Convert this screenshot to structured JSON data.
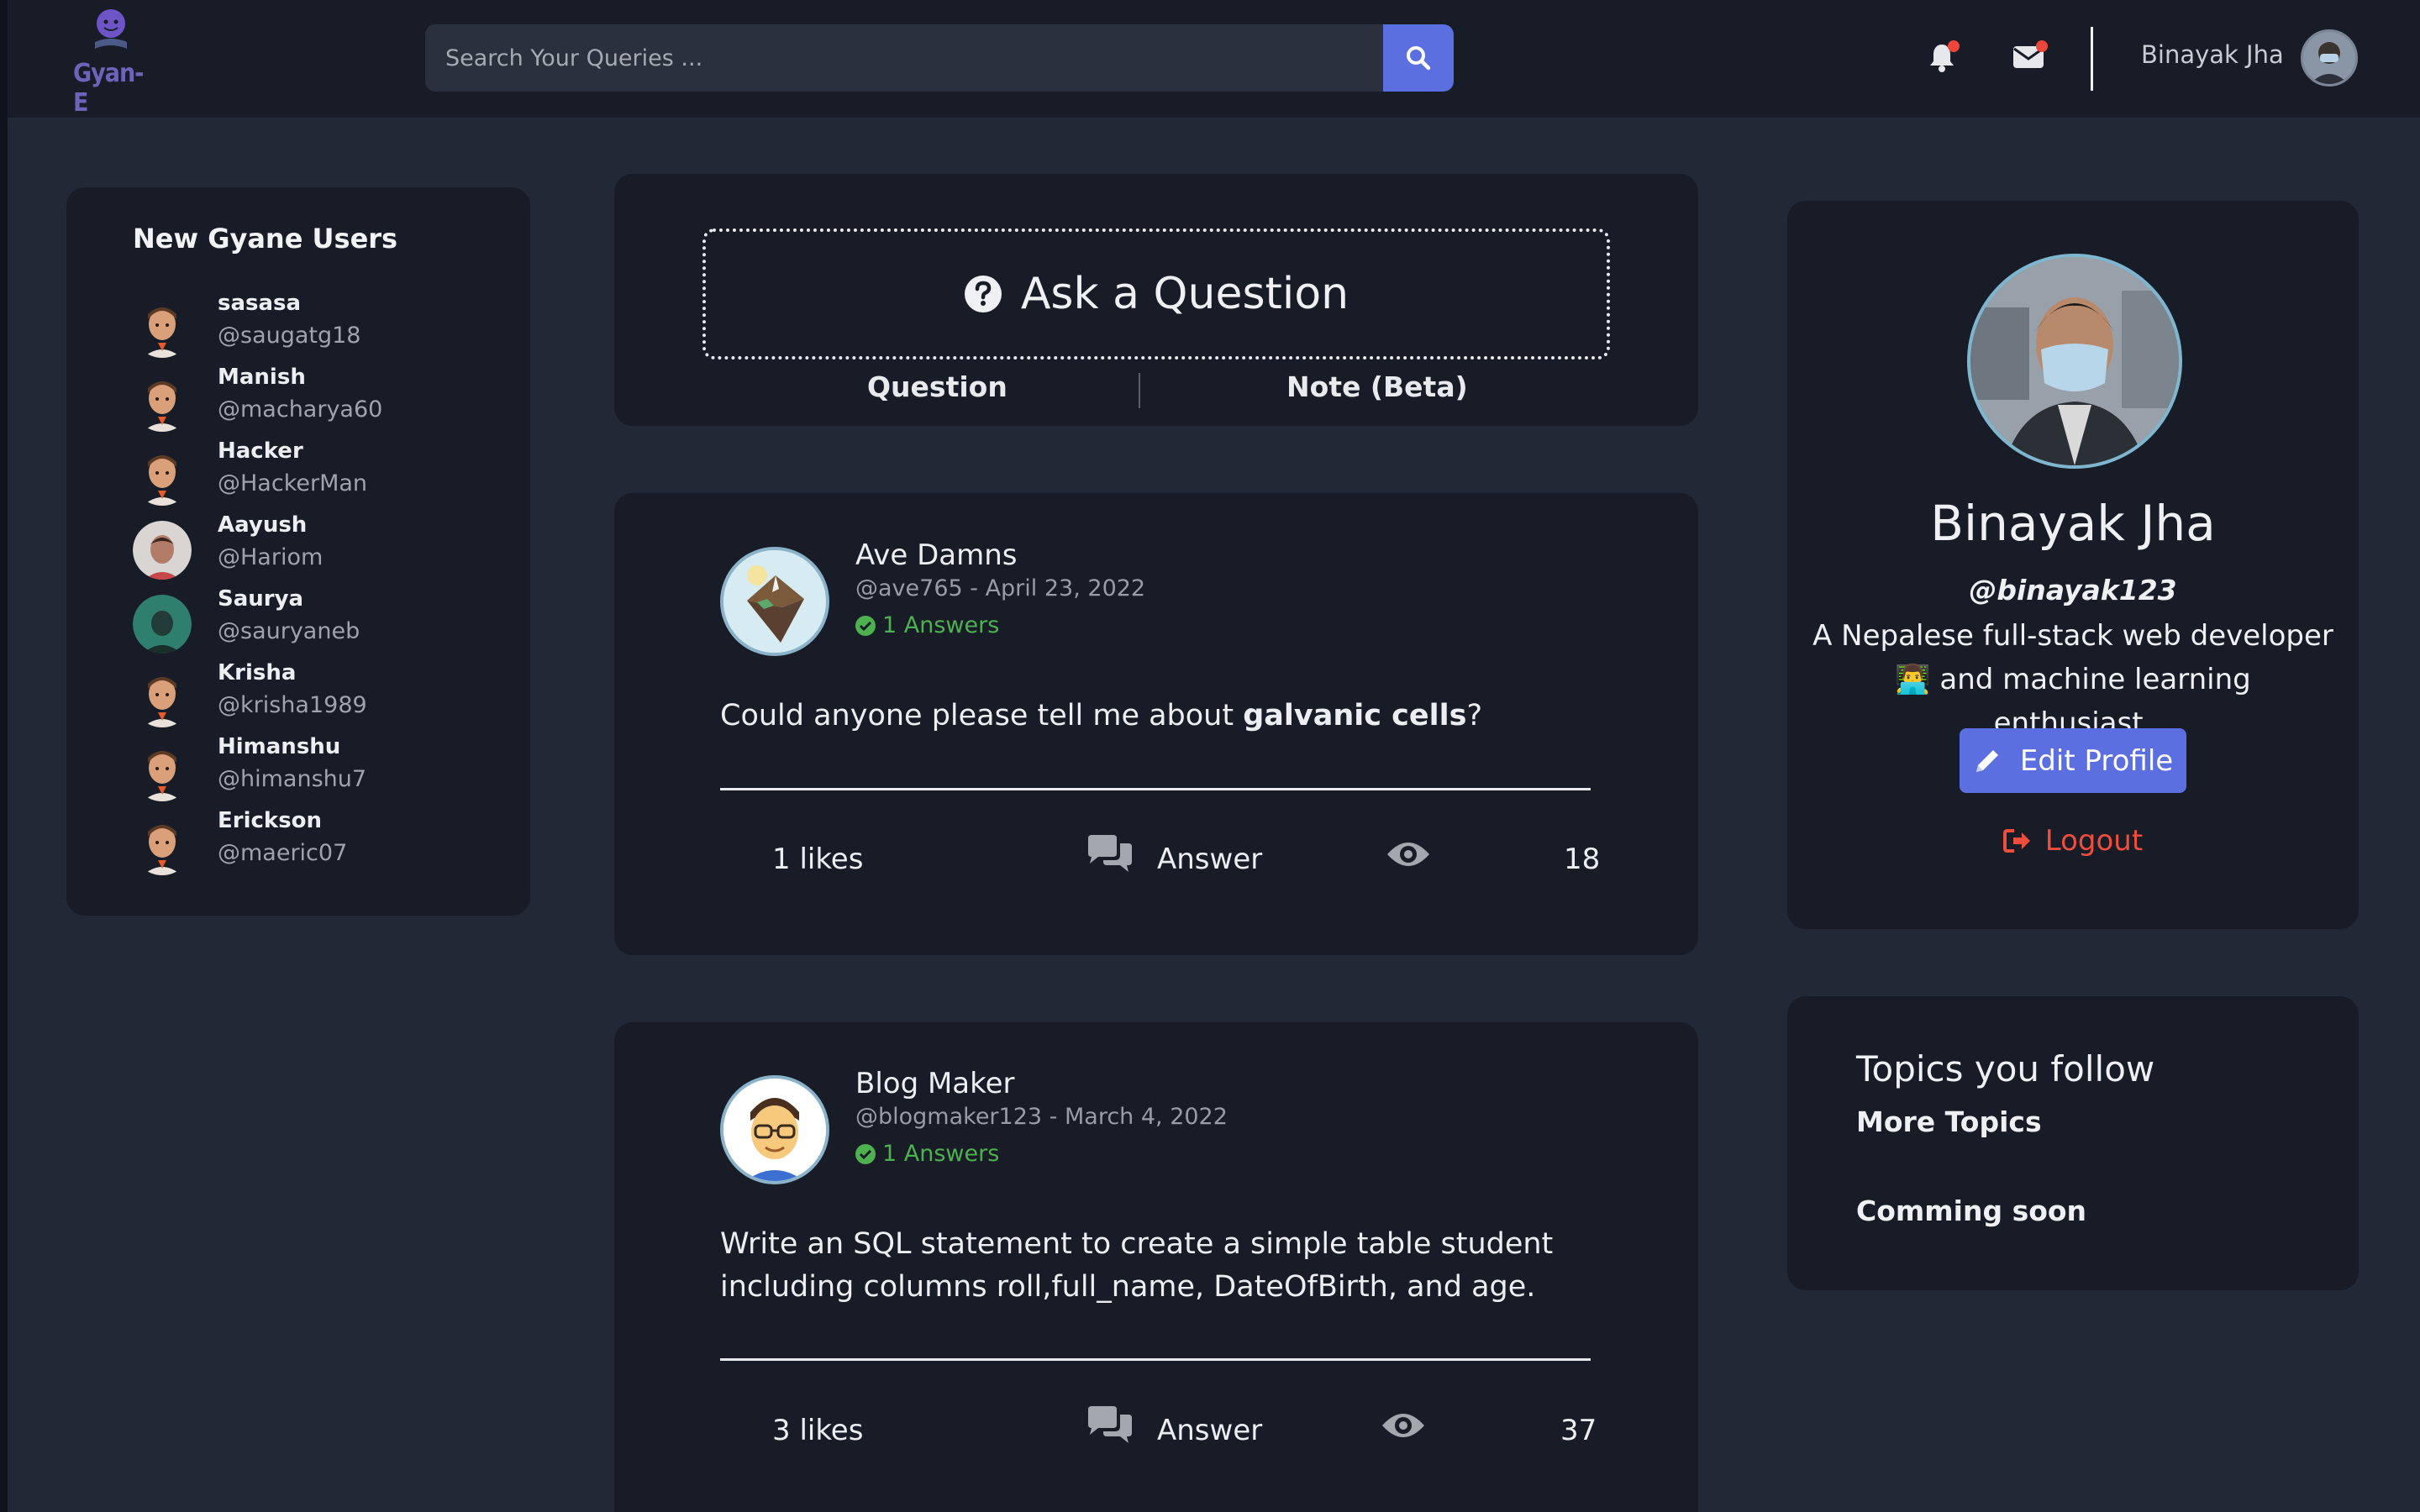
{
  "header": {
    "logo_text": "Gyan-E",
    "search_placeholder": "Search Your Queries ...",
    "username": "Binayak Jha"
  },
  "users_panel": {
    "title": "New Gyane Users",
    "users": [
      {
        "name": "sasasa",
        "handle": "@saugatg18"
      },
      {
        "name": "Manish",
        "handle": "@macharya60"
      },
      {
        "name": "Hacker",
        "handle": "@HackerMan"
      },
      {
        "name": "Aayush",
        "handle": "@Hariom"
      },
      {
        "name": "Saurya",
        "handle": "@sauryaneb"
      },
      {
        "name": "Krisha",
        "handle": "@krisha1989"
      },
      {
        "name": "Himanshu",
        "handle": "@himanshu7"
      },
      {
        "name": "Erickson",
        "handle": "@maeric07"
      }
    ]
  },
  "ask": {
    "label": "Ask a Question",
    "tabs": [
      "Question",
      "Note (Beta)"
    ]
  },
  "questions": [
    {
      "author": "Ave Damns",
      "meta": "@ave765 - April 23, 2022",
      "answers": "1 Answers",
      "text_before": "Could anyone please tell me about ",
      "text_bold": "galvanic cells",
      "text_after": "?",
      "likes": "1 likes",
      "answer_label": "Answer",
      "views": "18"
    },
    {
      "author": "Blog Maker",
      "meta": "@blogmaker123 - March 4, 2022",
      "answers": "1 Answers",
      "text_before": "Write an SQL statement to create a simple table student including columns roll,full_name, DateOfBirth, and age.",
      "text_bold": "",
      "text_after": "",
      "likes": "3 likes",
      "answer_label": "Answer",
      "views": "37"
    }
  ],
  "profile": {
    "name": "Binayak Jha",
    "handle": "@binayak123",
    "bio": "A Nepalese full-stack web developer 👨‍💻 and machine learning enthusiast.",
    "edit_label": "Edit Profile",
    "logout_label": "Logout"
  },
  "topics": {
    "title": "Topics you follow",
    "more": "More Topics",
    "coming_soon": "Comming soon"
  },
  "colors": {
    "background": "#212936",
    "card": "#171c27",
    "accent": "#5b6fe0",
    "answers_green": "#4db14f",
    "logout_red": "#ef4d3d",
    "notification_dot": "#f0453a"
  },
  "icons": [
    "bell-icon",
    "envelope-icon",
    "search-icon",
    "question-circle-icon",
    "check-circle-icon",
    "comments-icon",
    "eye-icon",
    "pencil-icon",
    "sign-out-icon"
  ]
}
